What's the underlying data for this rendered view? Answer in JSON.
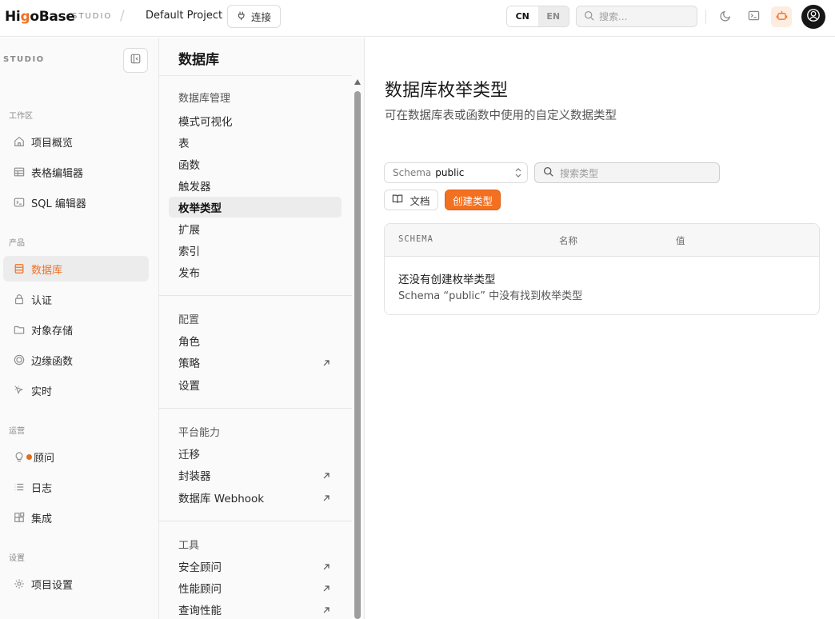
{
  "topbar": {
    "logo_prefix": "Hi",
    "logo_accent": "g",
    "logo_suffix": "oBase",
    "studio_tag": "STUDIO",
    "separator": "/",
    "project_name": "Default Project",
    "connect_label": "连接",
    "lang_cn": "CN",
    "lang_en": "EN",
    "search_placeholder": "搜索...",
    "accent_color": "#f37021"
  },
  "sidebar": {
    "studio_label": "STUDIO",
    "sections": {
      "workspace": "工作区",
      "product": "产品",
      "operations": "运营",
      "settings": "设置"
    },
    "items": [
      {
        "label": "项目概览",
        "icon": "home-icon"
      },
      {
        "label": "表格编辑器",
        "icon": "table-icon"
      },
      {
        "label": "SQL 编辑器",
        "icon": "terminal-icon"
      },
      {
        "label": "数据库",
        "icon": "database-icon",
        "active": true
      },
      {
        "label": "认证",
        "icon": "lock-icon"
      },
      {
        "label": "对象存储",
        "icon": "folder-icon"
      },
      {
        "label": "边缘函数",
        "icon": "globe-icon"
      },
      {
        "label": "实时",
        "icon": "cursor-icon"
      },
      {
        "label": "顾问",
        "icon": "lightbulb-icon"
      },
      {
        "label": "日志",
        "icon": "list-icon"
      },
      {
        "label": "集成",
        "icon": "blocks-icon"
      },
      {
        "label": "项目设置",
        "icon": "gear-icon"
      }
    ]
  },
  "midmenu": {
    "title": "数据库",
    "groups": {
      "management": "数据库管理",
      "config": "配置",
      "platform": "平台能力",
      "tools": "工具"
    },
    "management_items": [
      "模式可视化",
      "表",
      "函数",
      "触发器",
      "枚举类型",
      "扩展",
      "索引",
      "发布"
    ],
    "config_items": [
      "角色",
      "策略",
      "设置"
    ],
    "platform_items": [
      "迁移",
      "封装器",
      "数据库 Webhook"
    ],
    "tools_items": [
      "安全顾问",
      "性能顾问",
      "查询性能"
    ]
  },
  "main": {
    "title": "数据库枚举类型",
    "subtitle": "可在数据库表或函数中使用的自定义数据类型",
    "schema_label": "Schema",
    "schema_value": "public",
    "search_placeholder": "搜索类型",
    "docs_label": "文档",
    "create_label": "创建类型",
    "table": {
      "columns": [
        "SCHEMA",
        "名称",
        "值"
      ],
      "empty_title": "还没有创建枚举类型",
      "empty_sub": "Schema “public” 中没有找到枚举类型"
    }
  }
}
